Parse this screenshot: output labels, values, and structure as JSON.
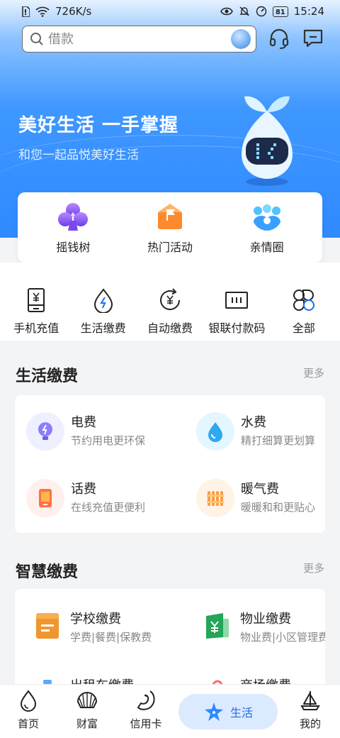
{
  "status": {
    "speed": "726K/s",
    "battery": "81",
    "time": "15:24"
  },
  "search": {
    "placeholder": "借款"
  },
  "hero": {
    "title": "美好生活 一手掌握",
    "subtitle": "和您一起品悦美好生活"
  },
  "quick_actions": [
    {
      "label": "摇钱树",
      "icon": "club-icon"
    },
    {
      "label": "热门活动",
      "icon": "flag-envelope-icon"
    },
    {
      "label": "亲情圈",
      "icon": "family-icon"
    }
  ],
  "services": [
    {
      "label": "手机充值",
      "icon": "phone-recharge-icon"
    },
    {
      "label": "生活缴费",
      "icon": "utility-drop-icon"
    },
    {
      "label": "自动缴费",
      "icon": "auto-pay-icon"
    },
    {
      "label": "银联付款码",
      "icon": "pay-code-icon"
    },
    {
      "label": "全部",
      "icon": "grid-all-icon"
    }
  ],
  "life_payment": {
    "title": "生活缴费",
    "more": "更多",
    "items": [
      {
        "name": "电费",
        "desc": "节约用电更环保",
        "icon": "lightbulb-icon"
      },
      {
        "name": "水费",
        "desc": "精打细算更划算",
        "icon": "water-drop-icon"
      },
      {
        "name": "话费",
        "desc": "在线充值更便利",
        "icon": "phone-bill-icon"
      },
      {
        "name": "暖气费",
        "desc": "暖暖和和更贴心",
        "icon": "radiator-icon"
      }
    ]
  },
  "smart_payment": {
    "title": "智慧缴费",
    "more": "更多",
    "items": [
      {
        "name": "学校缴费",
        "desc": "学费|餐费|保教费",
        "icon": "school-book-icon"
      },
      {
        "name": "物业缴费",
        "desc": "物业费|小区管理费",
        "icon": "property-fee-icon"
      },
      {
        "name": "出租车缴费",
        "icon": "taxi-icon"
      },
      {
        "name": "商场缴费",
        "icon": "mall-icon"
      }
    ]
  },
  "bottom_nav": [
    {
      "label": "首页",
      "icon": "home-drop-icon"
    },
    {
      "label": "财富",
      "icon": "shell-icon"
    },
    {
      "label": "信用卡",
      "icon": "conch-icon"
    },
    {
      "label": "生活",
      "icon": "starfish-icon",
      "active": true
    },
    {
      "label": "我的",
      "icon": "sailboat-icon"
    }
  ],
  "colors": {
    "primary_blue": "#2f8aff",
    "active_nav_bg": "#dceaff",
    "active_nav_text": "#1e6fe8"
  }
}
